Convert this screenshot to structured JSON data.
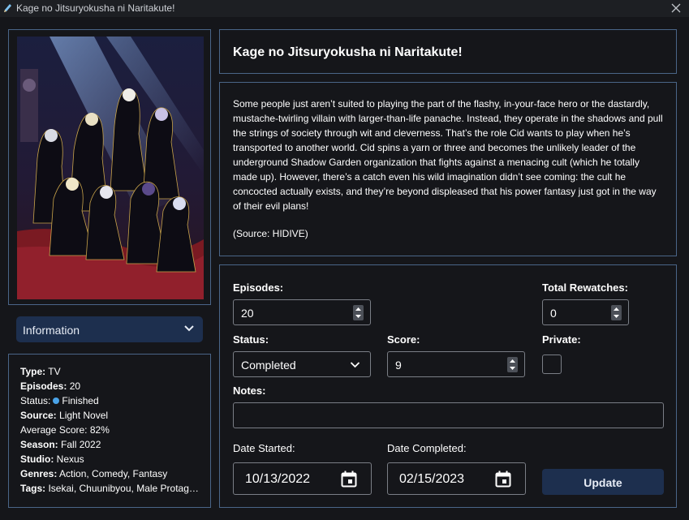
{
  "window": {
    "title": "Kage no Jitsuryokusha ni Naritakute!",
    "app_icon": "pencil-icon",
    "close_icon": "close-icon"
  },
  "colors": {
    "background": "#15161a",
    "panel_border": "#4a6588",
    "button_bg": "#1d2f4e",
    "status_dot": "#4aa3e8"
  },
  "cover": {
    "image": "anime-cover-art"
  },
  "sidebar": {
    "dropdown_label": "Information",
    "info": {
      "type_label": "Type:",
      "type_value": "TV",
      "episodes_label": "Episodes:",
      "episodes_value": "20",
      "status_label": "Status:",
      "status_value": "Finished",
      "source_label": "Source:",
      "source_value": "Light Novel",
      "score_label": "Average Score:",
      "score_value": "82%",
      "season_label": "Season:",
      "season_value": "Fall 2022",
      "studio_label": "Studio:",
      "studio_value": "Nexus",
      "genres_label": "Genres:",
      "genres_value": "Action, Comedy, Fantasy",
      "tags_label": "Tags:",
      "tags_value": "Isekai, Chuunibyou, Male Protagonist"
    }
  },
  "main": {
    "title": "Kage no Jitsuryokusha ni Naritakute!",
    "synopsis": "Some people just aren’t suited to playing the part of the flashy, in-your-face hero or the dastardly, mustache-twirling villain with larger-than-life panache. Instead, they operate in the shadows and pull the strings of society through wit and cleverness. That’s the role Cid wants to play when he’s transported to another world. Cid spins a yarn or three and becomes the unlikely leader of the underground Shadow Garden organization that fights against a menacing cult (which he totally made up). However, there’s a catch even his wild imagination didn’t see coming: the cult he concocted actually exists, and they’re beyond displeased that his power fantasy just got in the way of their evil plans!",
    "source": "(Source: HIDIVE)"
  },
  "form": {
    "episodes_label": "Episodes:",
    "episodes_value": "20",
    "rewatches_label": "Total Rewatches:",
    "rewatches_value": "0",
    "status_label": "Status:",
    "status_value": "Completed",
    "score_label": "Score:",
    "score_value": "9",
    "private_label": "Private:",
    "private_checked": false,
    "notes_label": "Notes:",
    "notes_value": "",
    "date_started_label": "Date Started:",
    "date_started_value": "10/13/2022",
    "date_completed_label": "Date Completed:",
    "date_completed_value": "02/15/2023",
    "update_label": "Update"
  }
}
